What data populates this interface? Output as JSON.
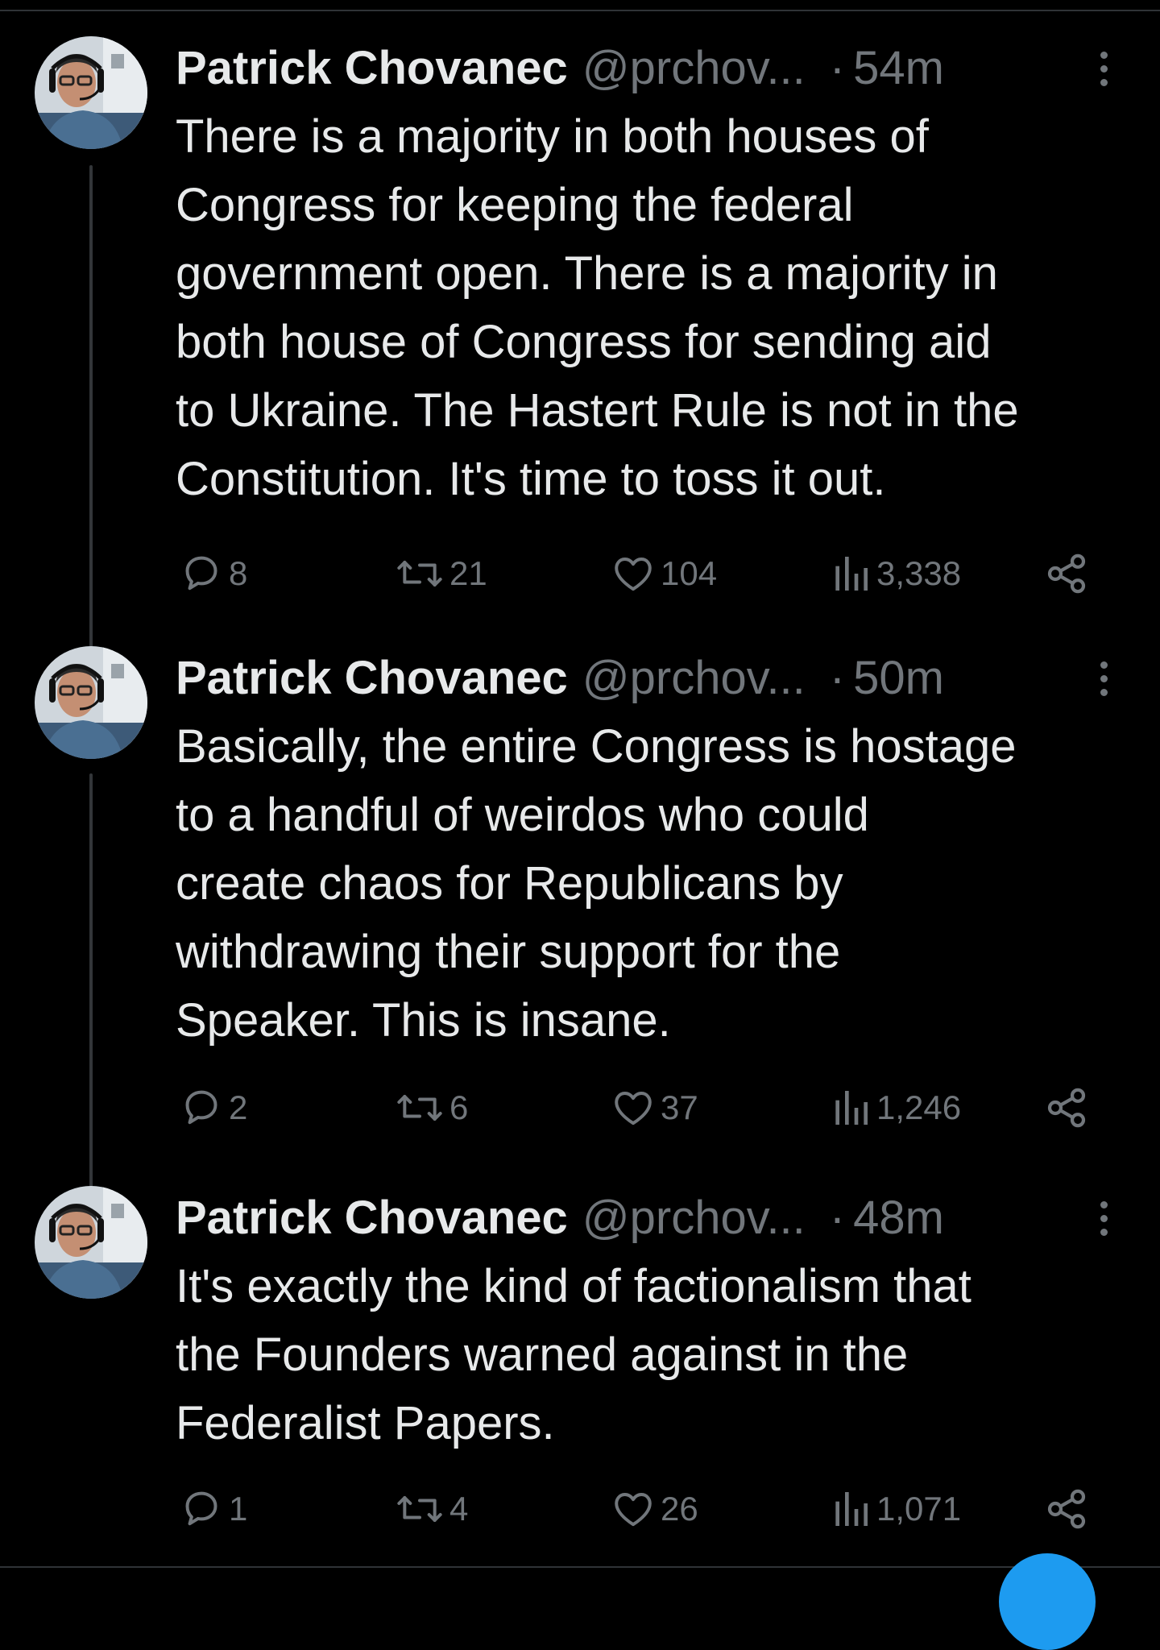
{
  "tweets": [
    {
      "author_name": "Patrick Chovanec",
      "handle": "@prchov...",
      "separator": "·",
      "time": "54m",
      "text": "There is a majority in both houses of\nCongress for keeping the federal\ngovernment open. There is a majority in\nboth house of Congress for sending aid\nto Ukraine. The Hastert Rule is not in the\nConstitution. It's time to toss it out.",
      "replies": "8",
      "reposts": "21",
      "likes": "104",
      "views": "3,338"
    },
    {
      "author_name": "Patrick Chovanec",
      "handle": "@prchov...",
      "separator": "·",
      "time": "50m",
      "text": "Basically, the entire Congress is hostage\nto a handful of weirdos who could\ncreate chaos for Republicans by\nwithdrawing their support for the\nSpeaker. This is insane.",
      "replies": "2",
      "reposts": "6",
      "likes": "37",
      "views": "1,246"
    },
    {
      "author_name": "Patrick Chovanec",
      "handle": "@prchov...",
      "separator": "·",
      "time": "48m",
      "text": "It's exactly the kind of factionalism that\nthe Founders warned against in the\nFederalist Papers.",
      "replies": "1",
      "reposts": "4",
      "likes": "26",
      "views": "1,071"
    }
  ],
  "icons": {
    "reply": "reply-icon",
    "repost": "repost-icon",
    "like": "heart-icon",
    "views": "views-icon",
    "share": "share-icon",
    "more": "more-icon"
  },
  "colors": {
    "background": "#000000",
    "text": "#e7e9ea",
    "secondary": "#71767b",
    "thread_line": "#333639",
    "accent": "#1d9bf0"
  }
}
